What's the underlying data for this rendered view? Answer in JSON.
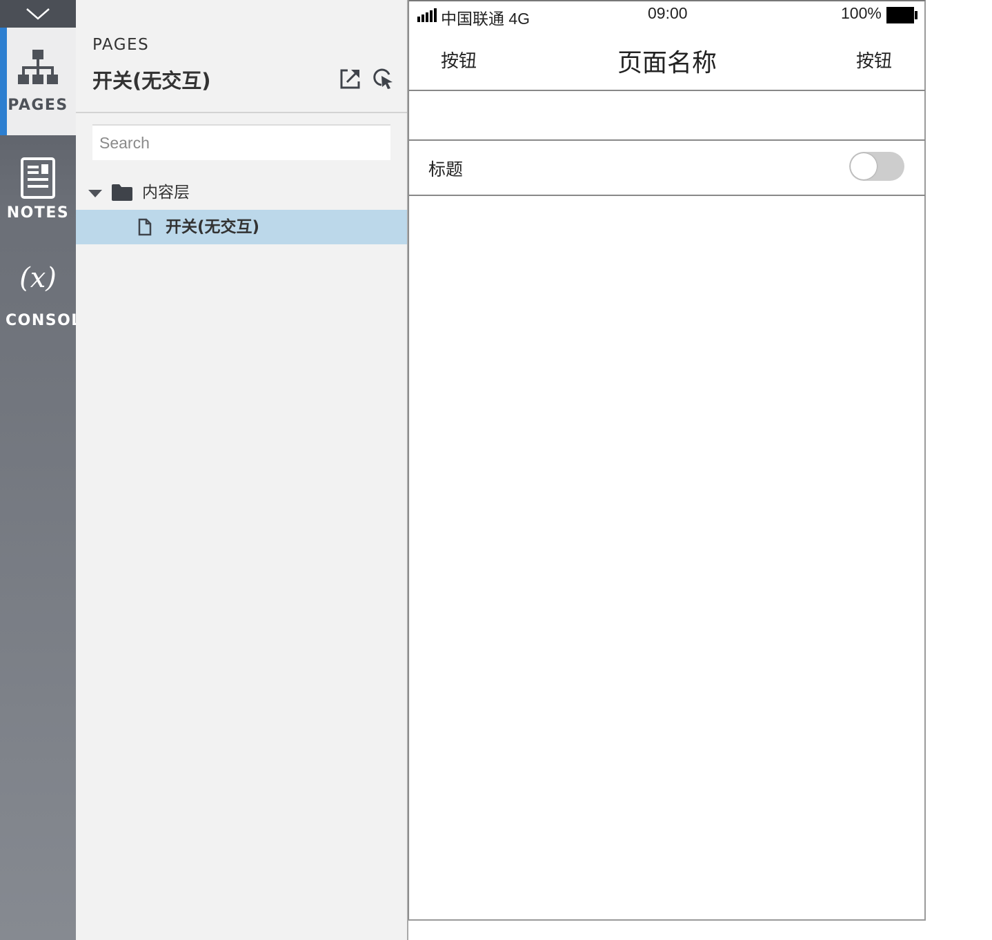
{
  "sidebar": {
    "collapse_icon": "chevron-down-icon",
    "tabs": [
      {
        "label": "PAGES",
        "icon": "sitemap-icon",
        "active": true
      },
      {
        "label": "NOTES",
        "icon": "notes-icon",
        "active": false
      },
      {
        "label": "CONSOLE",
        "icon": "variable-icon",
        "icon_text": "(x)",
        "active": false
      }
    ]
  },
  "panel": {
    "kicker": "PAGES",
    "title": "开关(无交互)",
    "actions": [
      "export-icon",
      "select-pointer-icon"
    ],
    "search": {
      "placeholder": "Search",
      "value": ""
    },
    "tree": {
      "folder": {
        "label": "内容层",
        "expanded": true
      },
      "pages": [
        {
          "label": "开关(无交互)",
          "selected": true
        }
      ]
    }
  },
  "phone": {
    "status_bar": {
      "carrier": "中国联通 4G",
      "time": "09:00",
      "battery": "100%"
    },
    "nav_bar": {
      "left_button": "按钮",
      "title": "页面名称",
      "right_button": "按钮"
    },
    "list": {
      "row_label": "标题",
      "toggle_on": false
    }
  },
  "colors": {
    "rail_top": "#4f535b",
    "rail_bottom": "#868a91",
    "active_accent": "#2d7fd0",
    "selected_row": "#bcd8ea",
    "panel_bg": "#f2f2f2",
    "toggle_off": "#cdcdcd"
  }
}
